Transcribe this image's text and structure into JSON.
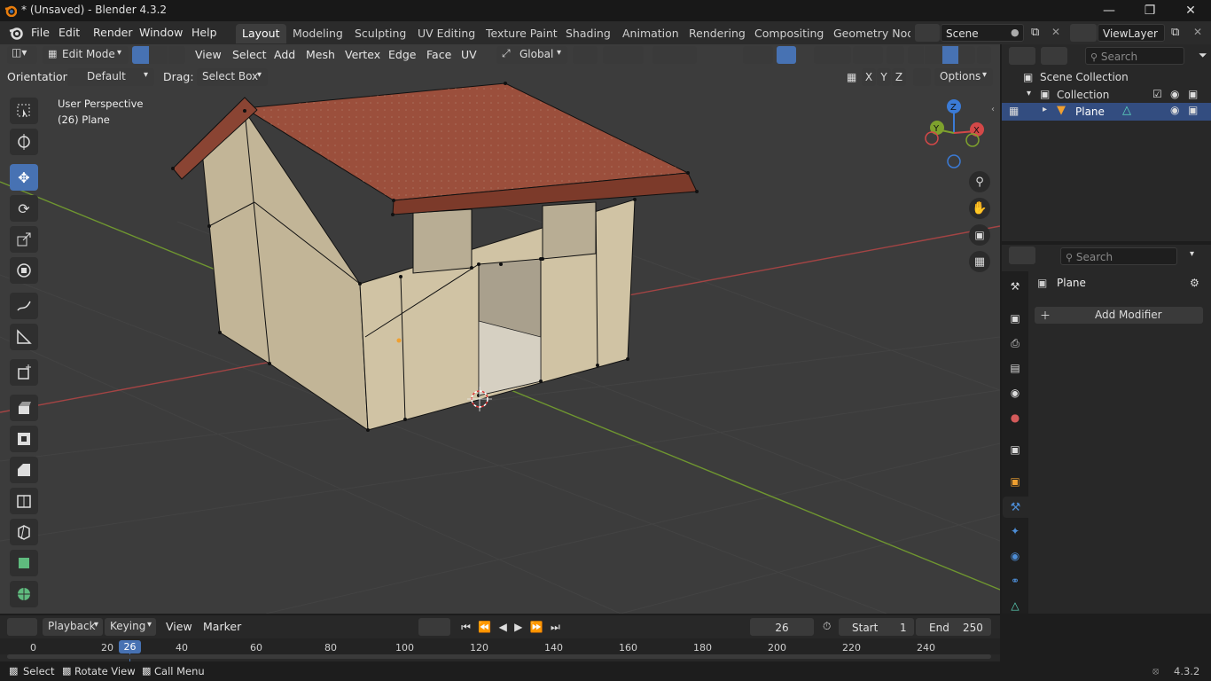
{
  "window": {
    "title": "* (Unsaved) - Blender 4.3.2"
  },
  "menu": {
    "items": [
      "File",
      "Edit",
      "Render",
      "Window",
      "Help"
    ]
  },
  "workspaces": [
    "Layout",
    "Modeling",
    "Sculpting",
    "UV Editing",
    "Texture Paint",
    "Shading",
    "Animation",
    "Rendering",
    "Compositing",
    "Geometry Node"
  ],
  "scene": {
    "name": "Scene",
    "view_layer": "ViewLayer"
  },
  "header": {
    "mode": "Edit Mode",
    "menus": [
      "View",
      "Select",
      "Add",
      "Mesh",
      "Vertex",
      "Edge",
      "Face",
      "UV"
    ],
    "transform_orientation": "Global",
    "orientation_label": "Orientation:",
    "orientation_value": "Default",
    "drag_label": "Drag:",
    "drag_value": "Select Box",
    "axes": [
      "X",
      "Y",
      "Z"
    ],
    "options": "Options"
  },
  "viewport": {
    "perspective": "User Perspective",
    "object": "(26) Plane"
  },
  "gizmo": {
    "x": "X",
    "y": "Y",
    "z": "Z"
  },
  "outliner": {
    "search_placeholder": "Search",
    "scene_collection": "Scene Collection",
    "collection": "Collection",
    "object": "Plane"
  },
  "properties": {
    "search_placeholder": "Search",
    "object_name": "Plane",
    "add_modifier": "Add Modifier"
  },
  "timeline": {
    "menus": [
      "Playback",
      "Keying",
      "View",
      "Marker"
    ],
    "current_frame": "26",
    "start_label": "Start",
    "start": "1",
    "end_label": "End",
    "end": "250",
    "ticks": [
      "0",
      "20",
      "40",
      "60",
      "80",
      "100",
      "120",
      "140",
      "160",
      "180",
      "200",
      "220",
      "240"
    ],
    "marker": "26"
  },
  "status": {
    "select": "Select",
    "rotate": "Rotate View",
    "call_menu": "Call Menu",
    "version": "4.3.2"
  },
  "colors": {
    "accent": "#4772b3",
    "roof": "#9b4f3c",
    "wall": "#cdbf9f",
    "grid_x": "#b04848",
    "grid_y": "#7ea12d"
  }
}
